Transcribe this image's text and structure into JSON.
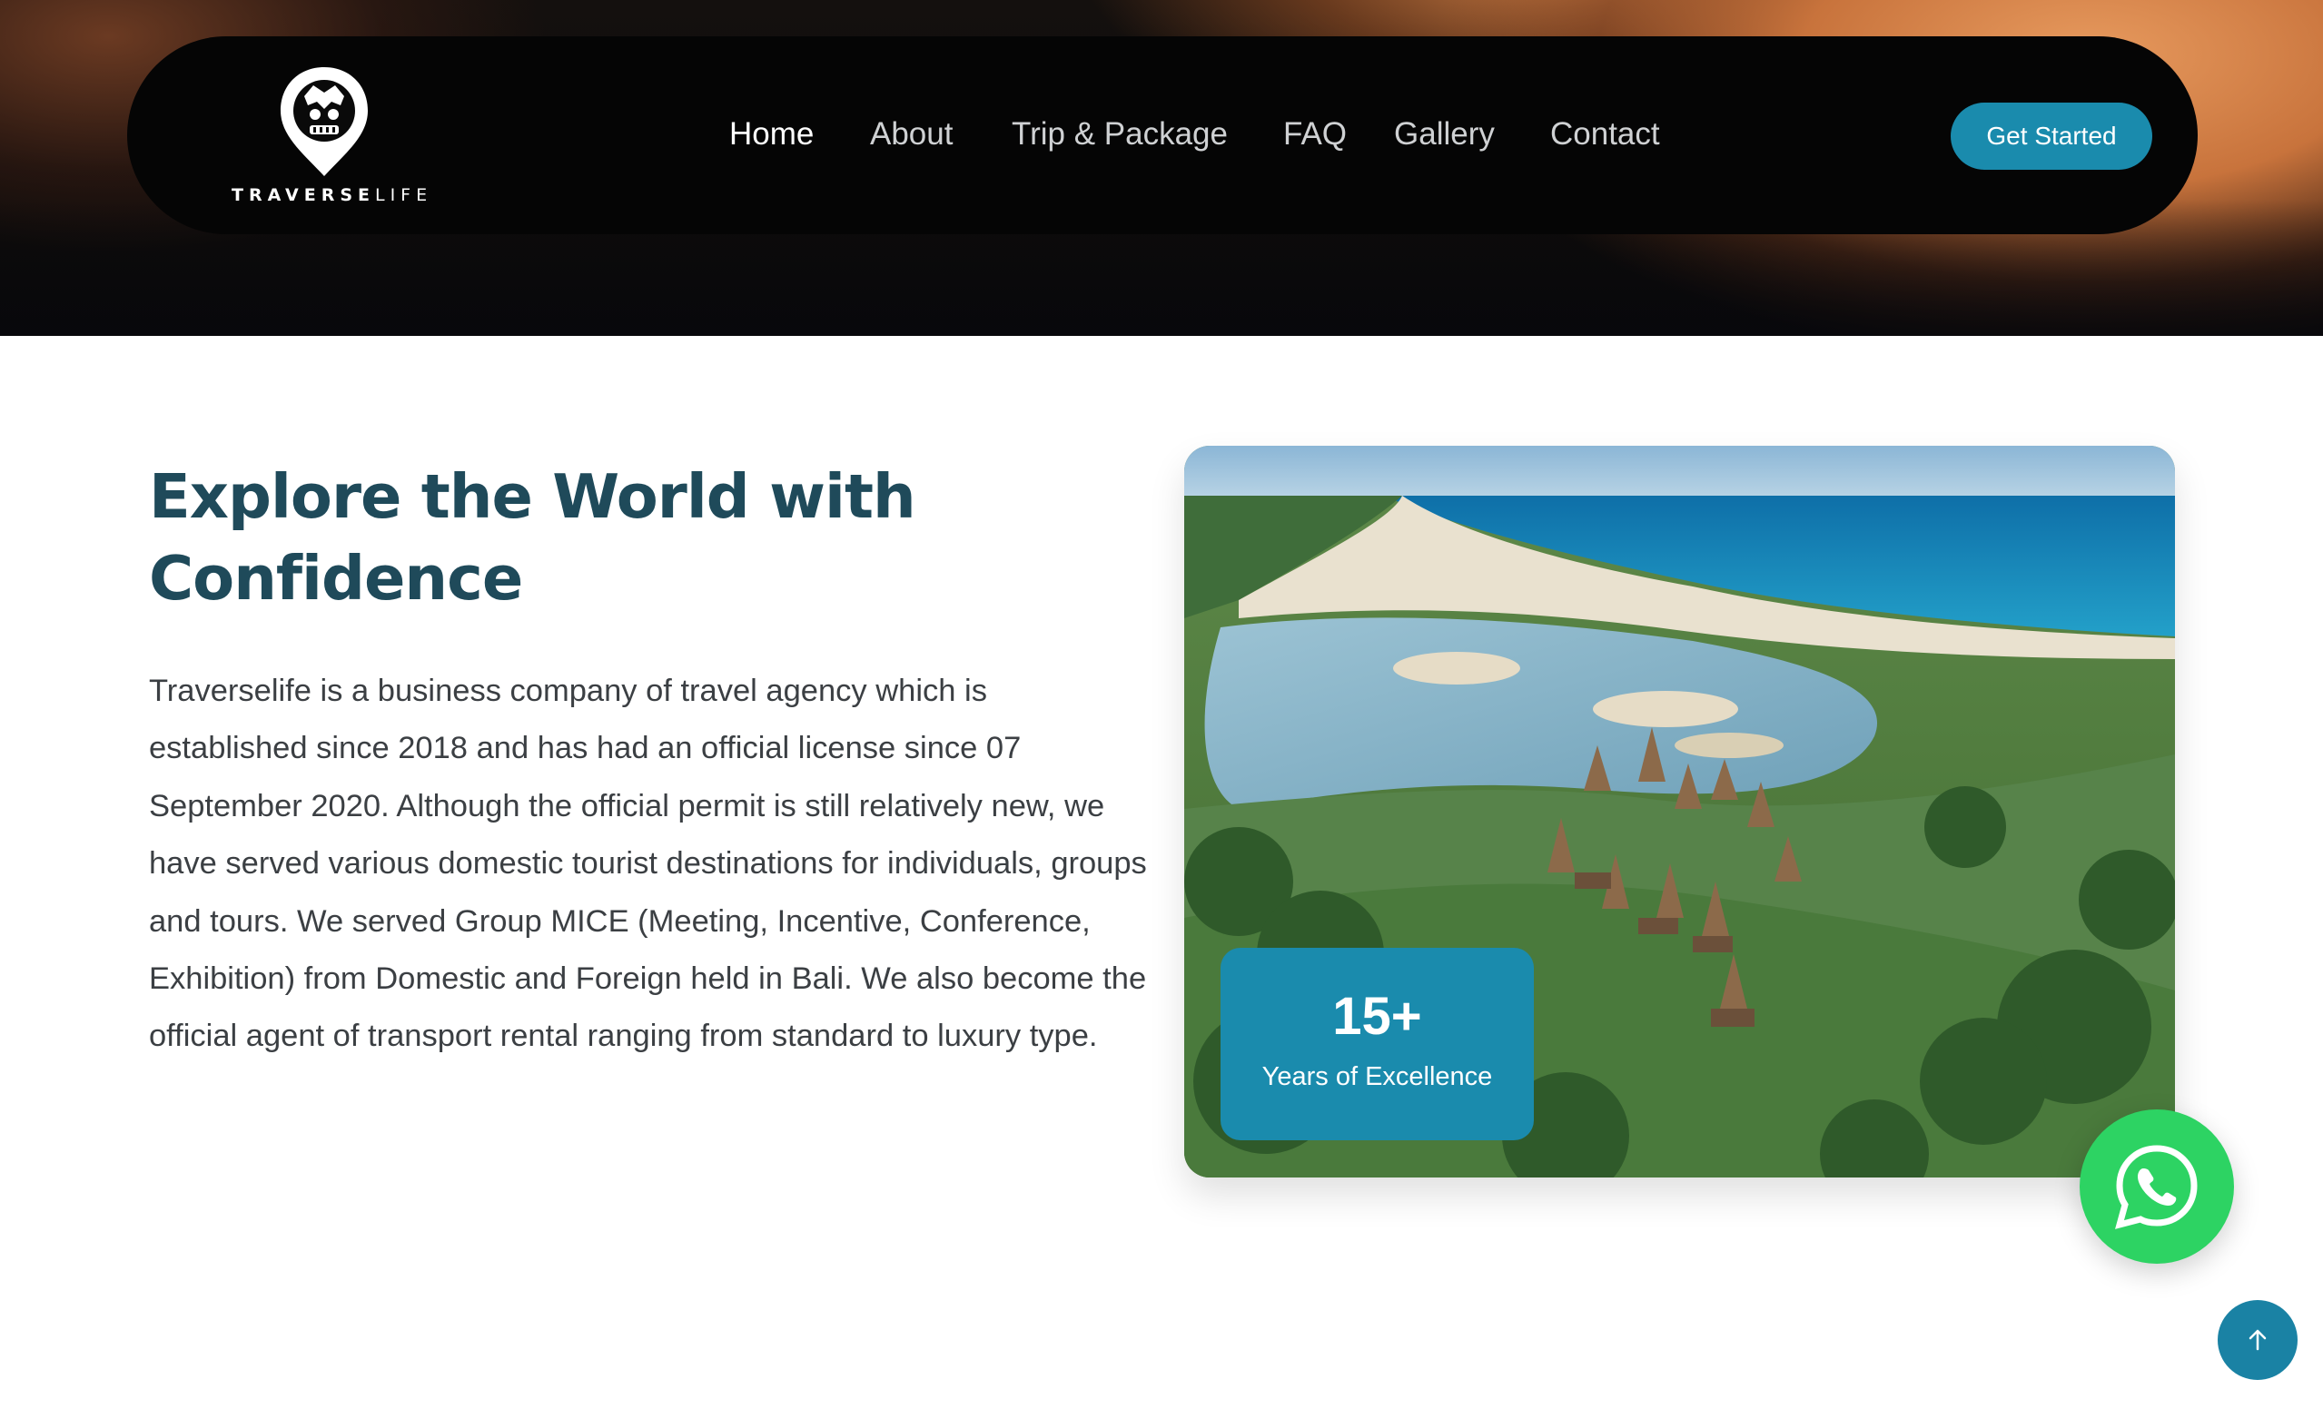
{
  "brand": {
    "logo_bold": "TRAVERSE",
    "logo_light": "LIFE"
  },
  "nav": {
    "items": [
      "Home",
      "About",
      "Trip & Package",
      "FAQ",
      "Gallery",
      "Contact"
    ],
    "active": "Home",
    "cta_label": "Get Started"
  },
  "about": {
    "heading": "Explore the World with Confidence",
    "body": "Traverselife is a business company of travel agency which is established since 2018 and has had an official license since 07 September 2020. Although the official permit is still relatively new, we have served various domestic tourist destinations for individuals, groups and tours. We served Group MICE (Meeting, Incentive, Conference, Exhibition) from Domestic and Foreign held in Bali. We also become the official agent of transport rental ranging from standard to luxury type.",
    "badge_value": "15+",
    "badge_label": "Years of Excellence"
  },
  "colors": {
    "accent": "#1a8bad",
    "heading": "#1f4a5a",
    "whatsapp": "#2dd363"
  },
  "icons": {
    "whatsapp": "whatsapp-icon",
    "scroll_top": "arrow-up-icon"
  }
}
